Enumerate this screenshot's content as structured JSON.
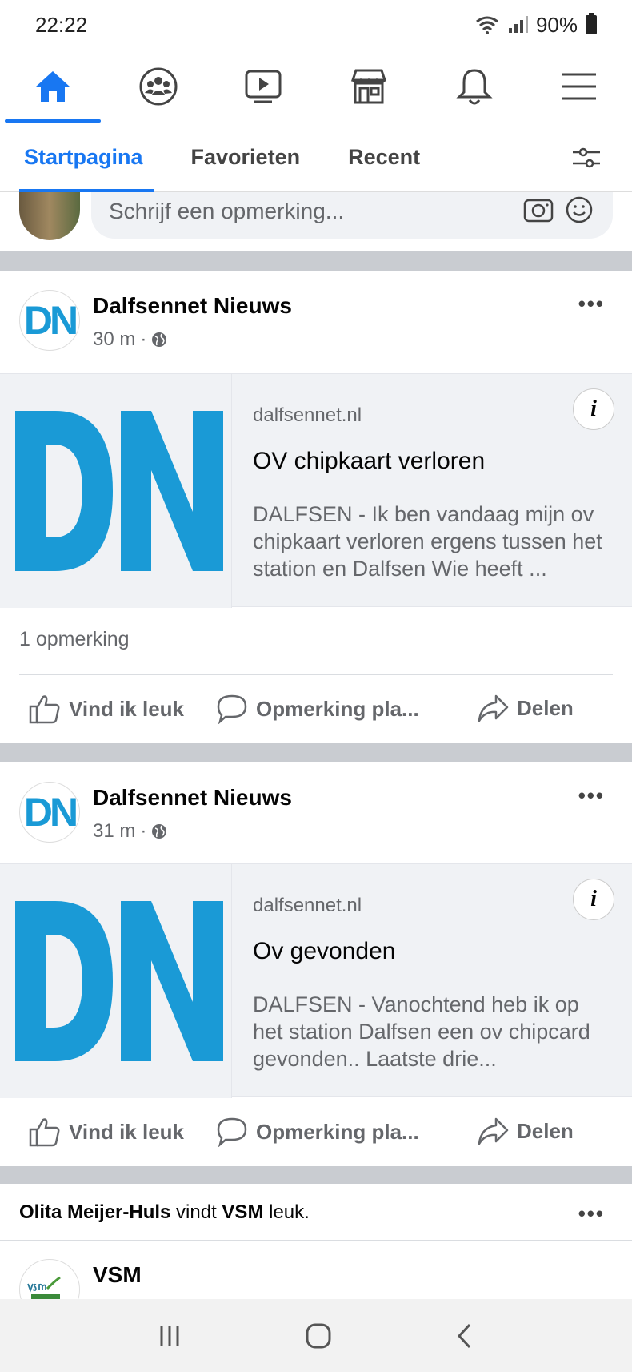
{
  "status": {
    "time": "22:22",
    "battery": "90%"
  },
  "nav": {
    "icons": [
      "home-icon",
      "groups-icon",
      "watch-icon",
      "marketplace-icon",
      "notifications-icon",
      "menu-icon"
    ],
    "active": "home"
  },
  "feed_tabs": [
    "Startpagina",
    "Favorieten",
    "Recent"
  ],
  "comment_box": {
    "placeholder": "Schrijf een opmerking..."
  },
  "posts": [
    {
      "author": "Dalfsennet Nieuws",
      "time": "30 m",
      "avatar_text": "DN",
      "link": {
        "domain": "dalfsennet.nl",
        "title": "OV chipkaart verloren",
        "description": "DALFSEN - Ik ben vandaag mijn ov chipkaart verloren ergens tussen het station en Dalfsen Wie heeft ..."
      },
      "comment_count": "1 opmerking",
      "actions": [
        "Vind ik leuk",
        "Opmerking pla...",
        "Delen"
      ]
    },
    {
      "author": "Dalfsennet Nieuws",
      "time": "31 m",
      "avatar_text": "DN",
      "link": {
        "domain": "dalfsennet.nl",
        "title": "Ov gevonden",
        "description": "DALFSEN - Vanochtend heb ik op het station Dalfsen een ov chipcard gevonden.. Laatste drie..."
      },
      "actions": [
        "Vind ik leuk",
        "Opmerking pla...",
        "Delen"
      ]
    }
  ],
  "activity": {
    "person": "Olita Meijer-Huls",
    "verb": "vindt",
    "page": "VSM",
    "suffix": "leuk."
  },
  "vsm_post": {
    "author": "VSM"
  },
  "colors": {
    "brand_blue": "#1877f2",
    "dn_blue": "#1a9ad6",
    "separator": "#c9ccd1"
  }
}
